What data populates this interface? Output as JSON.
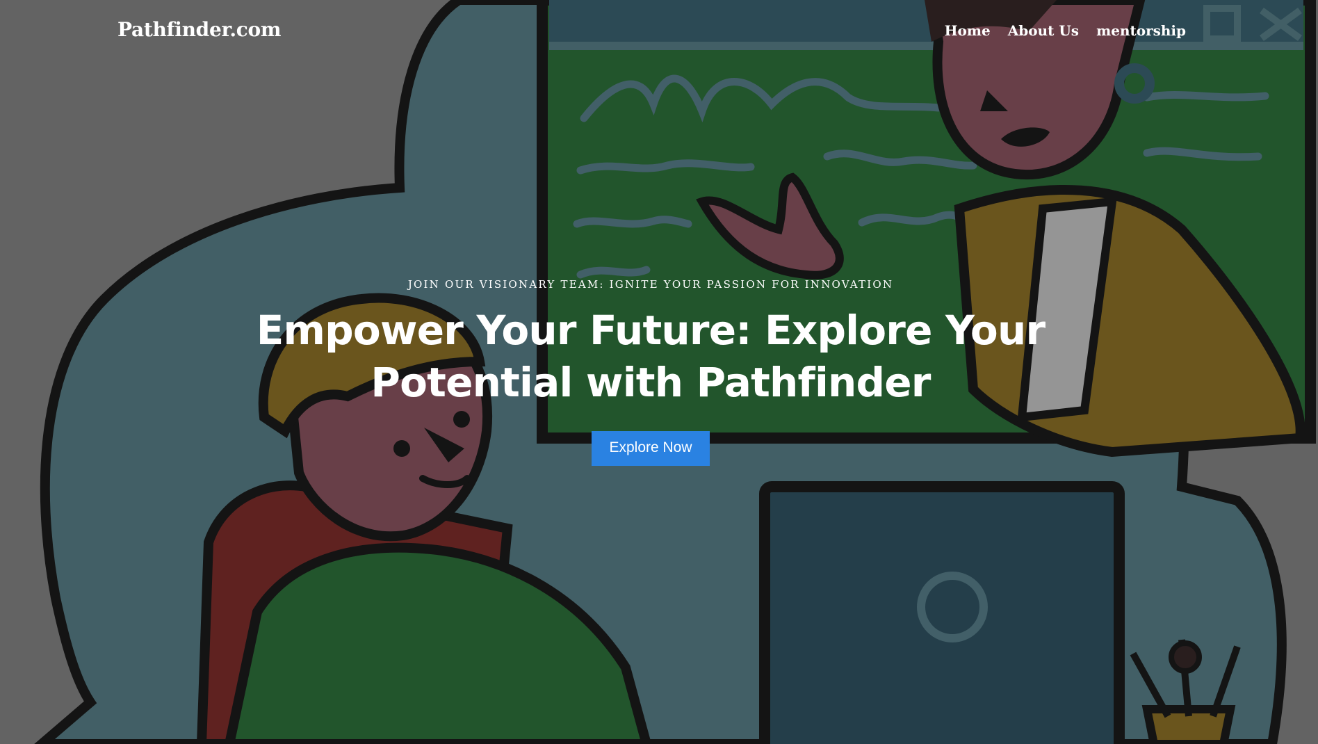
{
  "navbar": {
    "brand": "Pathfinder.com",
    "links": [
      "Home",
      "About Us",
      "mentorship"
    ]
  },
  "hero": {
    "eyebrow": "JOIN OUR VISIONARY TEAM: IGNITE YOUR PASSION FOR INNOVATION",
    "headline": "Empower Your Future: Explore Your Potential with Pathfinder",
    "cta_label": "Explore Now"
  },
  "colors": {
    "cta_background": "#2a82e2",
    "text": "#ffffff",
    "overlay": "#808080"
  },
  "icons": [
    "window-maximize-icon",
    "window-close-icon",
    "laptop-logo-icon"
  ]
}
